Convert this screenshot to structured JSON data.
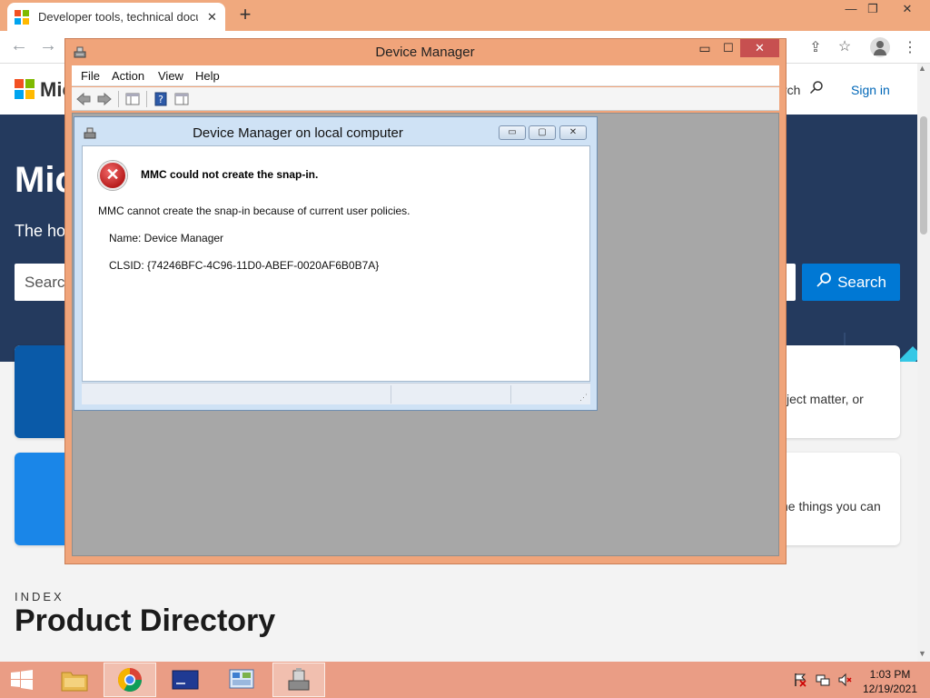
{
  "browser": {
    "tab_title": "Developer tools, technical documentation and coding examples | Microsoft Docs",
    "tab_close": "✕",
    "new_tab": "+",
    "min": "—",
    "restore": "❐",
    "close": "✕",
    "back": "←",
    "forward": "→"
  },
  "website": {
    "brand": "Mic",
    "search_link": "rch",
    "signin": "Sign in",
    "hero_title": "Mic",
    "hero_sub": "The ho",
    "search_placeholder": "Searc",
    "search_button": "Search",
    "card1_text": "ject matter, or",
    "card2_text": "he things you can",
    "index_label": "INDEX",
    "product_directory": "Product Directory"
  },
  "device_manager": {
    "title": "Device Manager",
    "menu": [
      "File",
      "Action",
      "View",
      "Help"
    ],
    "min": "▭",
    "max": "☐",
    "close": "✕",
    "child": {
      "title": "Device Manager on local computer",
      "min": "▭",
      "max": "▢",
      "close": "✕",
      "error_heading": "MMC could not create the snap-in.",
      "error_message": "MMC cannot create the snap-in because of current user policies.",
      "name_line": "Name: Device Manager",
      "clsid_line": "CLSID: {74246BFC-4C96-11D0-ABEF-0020AF6B0B7A}"
    }
  },
  "taskbar": {
    "time": "1:03 PM",
    "date": "12/19/2021"
  },
  "colors": {
    "chrome_frame": "#f0a97e",
    "hero_bg": "#243a5e",
    "accent_blue": "#0078d4",
    "taskbar": "#ea9d85",
    "close_red": "#c75050"
  }
}
